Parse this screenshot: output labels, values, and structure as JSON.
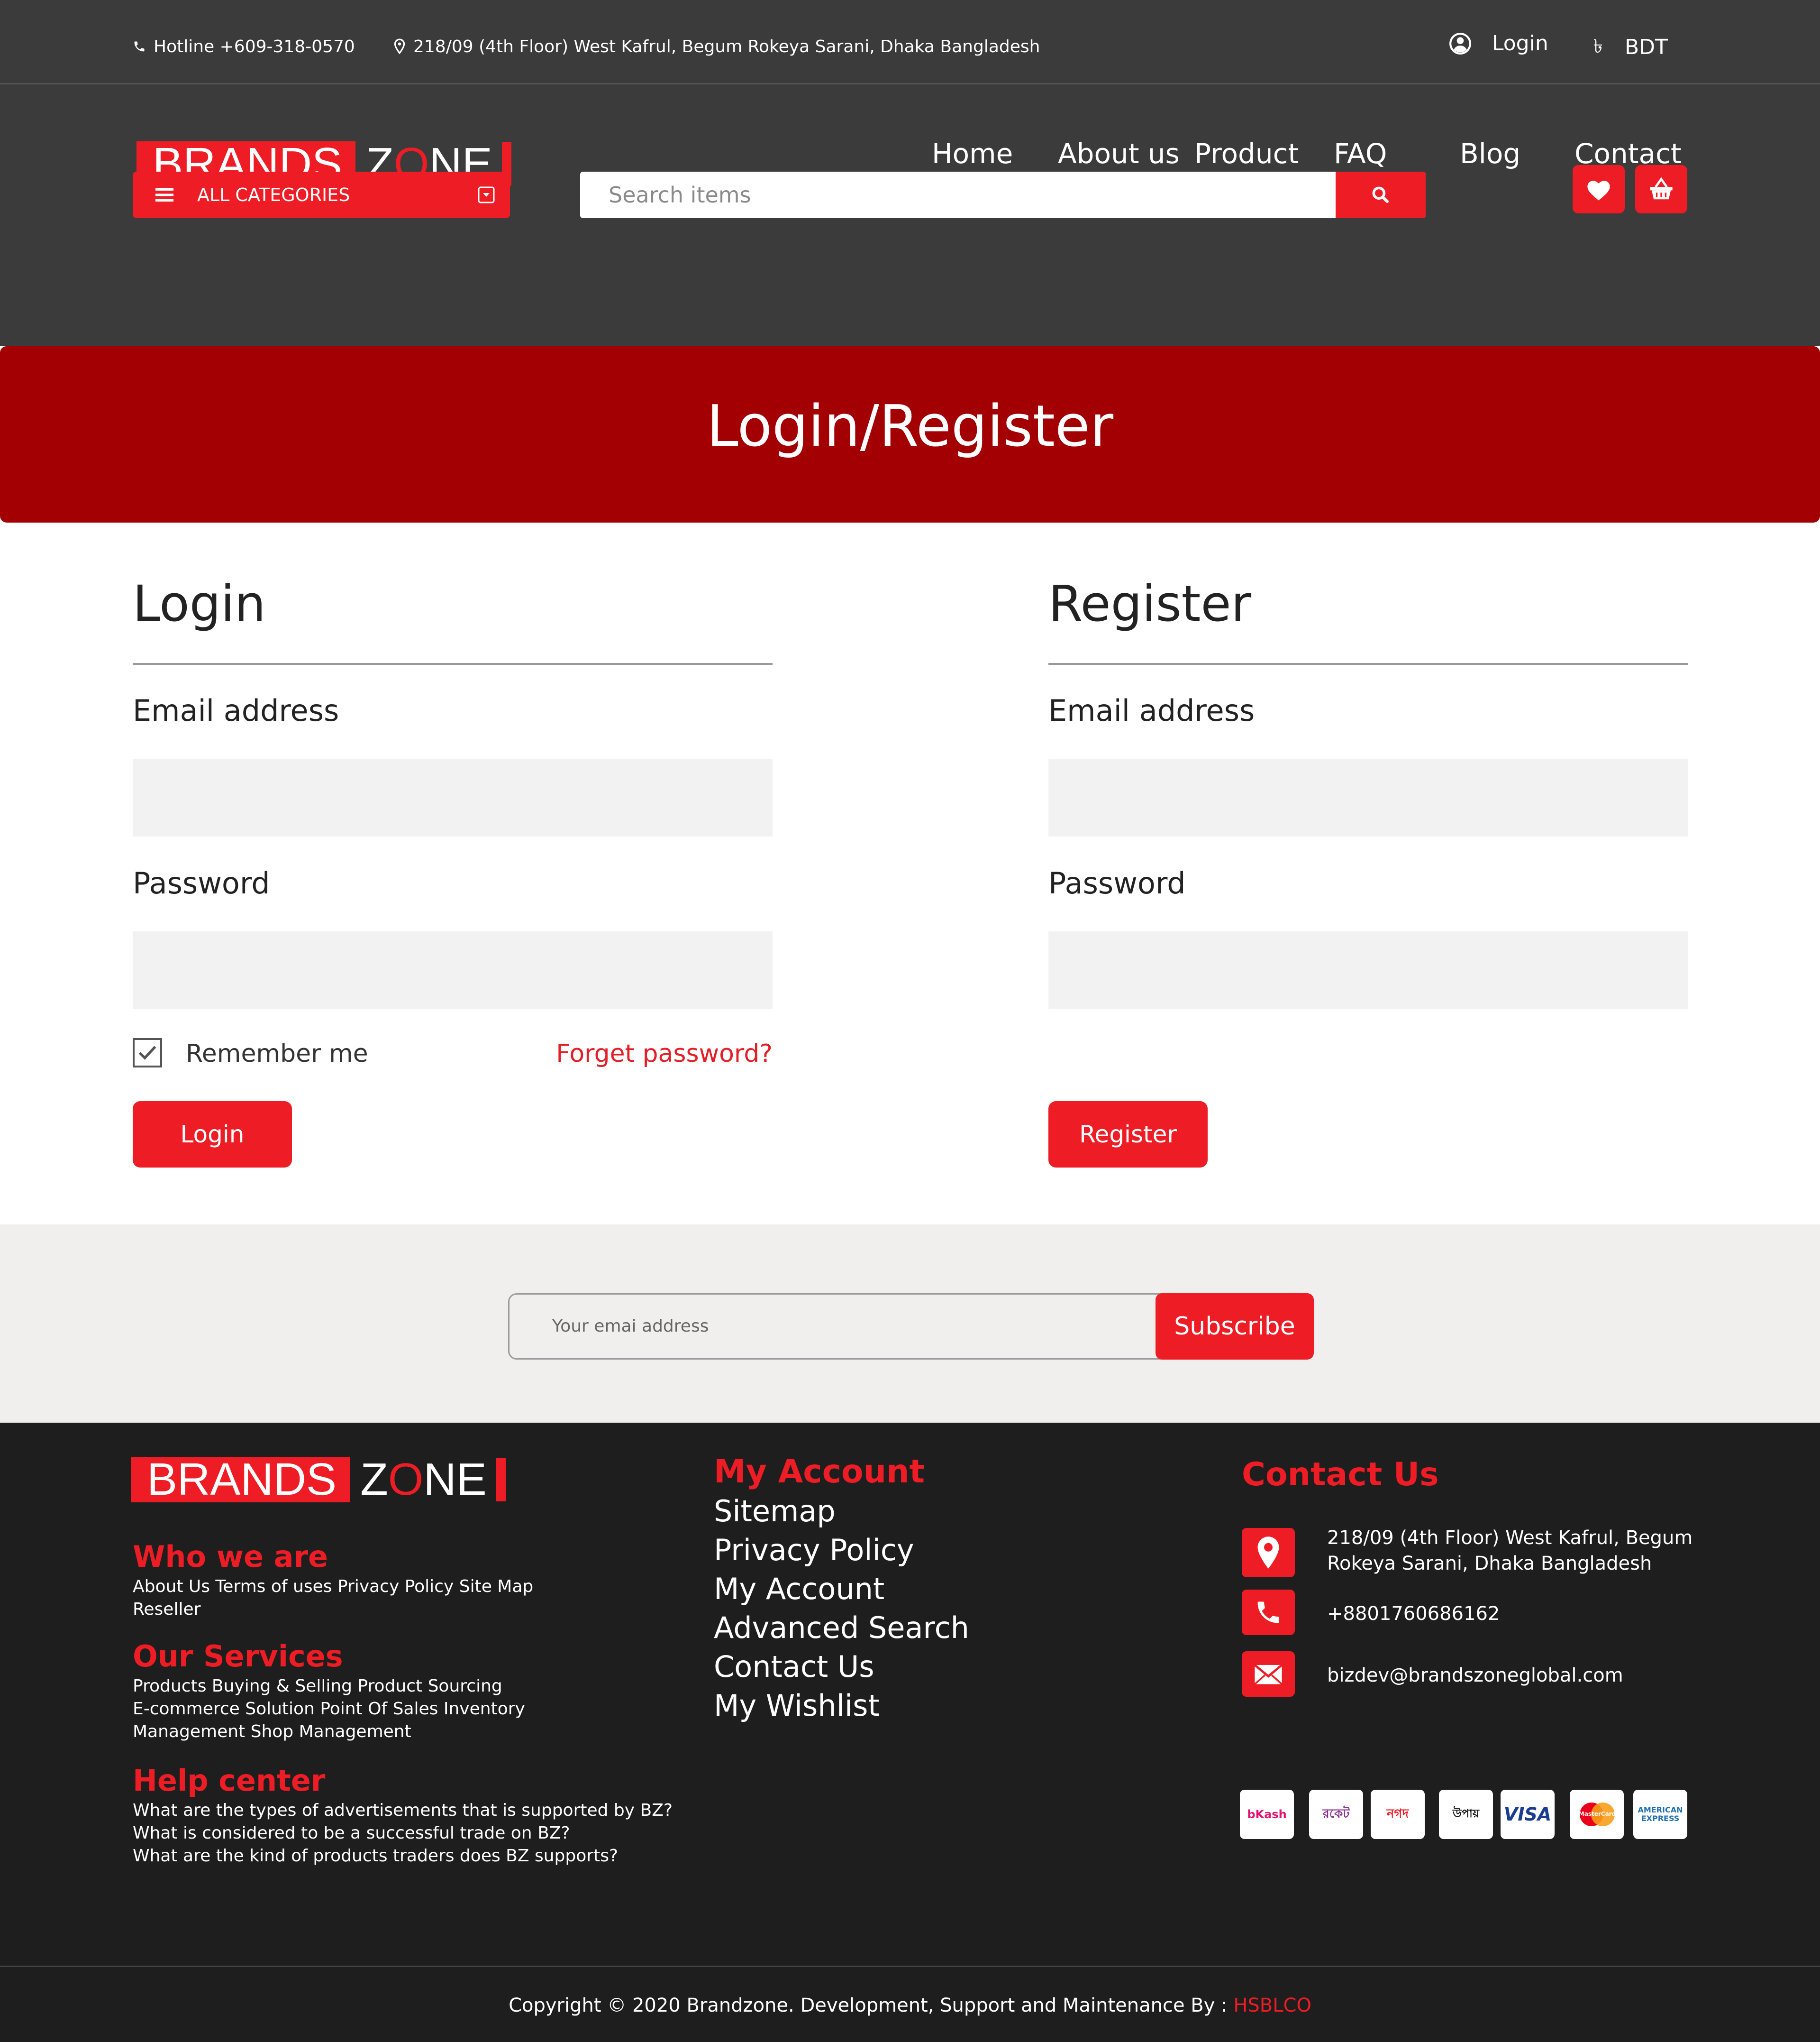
{
  "topbar": {
    "hotline": "Hotline +609-318-0570",
    "address": "218/09 (4th Floor) West Kafrul, Begum Rokeya Sarani, Dhaka Bangladesh",
    "login": "Login",
    "currency": "BDT"
  },
  "logo": {
    "brand": "BRANDS",
    "zone_z": "Z",
    "zone_o": "O",
    "zone_ne": "NE"
  },
  "nav": [
    "Home",
    "About us",
    "Product",
    "FAQ",
    "Blog",
    "Contact"
  ],
  "categories_label": "ALL CATEGORIES",
  "search": {
    "placeholder": "Search items"
  },
  "banner": {
    "title": "Login/Register"
  },
  "login_form": {
    "title": "Login",
    "email_label": "Email address",
    "password_label": "Password",
    "remember_label": "Remember me",
    "remember_checked": true,
    "forget_label": "Forget password?",
    "button": "Login"
  },
  "register_form": {
    "title": "Register",
    "email_label": "Email address",
    "password_label": "Password",
    "button": "Register"
  },
  "newsletter": {
    "placeholder": "Your emai address",
    "button": "Subscribe"
  },
  "footer": {
    "who_title": "Who we are",
    "who_text_1": "About Us Terms of uses Privacy Policy Site Map",
    "who_text_2": "Reseller",
    "services_title": "Our Services",
    "services_text_1": "Products Buying & Selling Product Sourcing",
    "services_text_2": "E-commerce Solution Point Of Sales Inventory",
    "services_text_3": "Management Shop Management",
    "help_title": "Help center",
    "help_text_1": "What are the types of advertisements that is supported by BZ?",
    "help_text_2": "What is considered to be a successful trade on BZ?",
    "help_text_3": "What are the kind of products traders does BZ supports?",
    "account_title": "My Account",
    "account_links": [
      "Sitemap",
      "Privacy Policy",
      "My Account",
      "Advanced Search",
      "Contact Us",
      "My Wishlist"
    ],
    "contact_title": "Contact Us",
    "contact_address_1": "218/09 (4th Floor) West Kafrul, Begum",
    "contact_address_2": "Rokeya Sarani, Dhaka Bangladesh",
    "contact_phone": "+8801760686162",
    "contact_email": "bizdev@brandszoneglobal.com",
    "payments": [
      "bKash",
      "রকেট",
      "নগদ",
      "উপায়",
      "VISA",
      "MasterCard",
      "AMERICAN EXPRESS"
    ]
  },
  "copyright": {
    "text": "Copyright © 2020 Brandzone. Development, Support and Maintenance By : ",
    "company": "HSBLCO"
  },
  "colors": {
    "accent": "#ee1c25",
    "banner": "#a30004",
    "header_bg": "#3b3b3b",
    "footer_bg": "#1e1e1e"
  }
}
